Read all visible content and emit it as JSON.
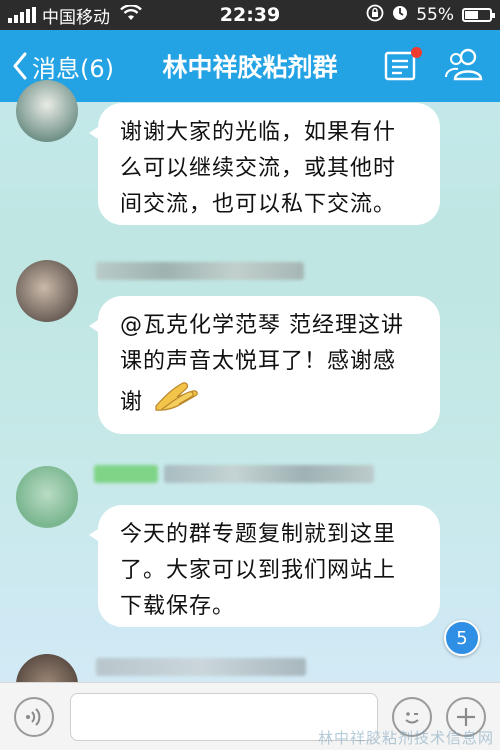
{
  "status_bar": {
    "carrier": "中国移动",
    "time": "22:39",
    "battery": "55%",
    "battery_level": 0.55
  },
  "nav": {
    "back_label": "消息(6)",
    "title": "林中祥胶粘剂群",
    "icons": [
      "back-chevron-icon",
      "group-notice-icon",
      "group-members-icon"
    ]
  },
  "messages": [
    {
      "text": "谢谢大家的光临，如果有什么可以继续交流，或其他时间交流，也可以私下交流。"
    },
    {
      "text": "@瓦克化学范琴 范经理这讲课的声音太悦耳了！感谢感谢",
      "emoji": "applause-icon"
    },
    {
      "text": "今天的群专题复制就到这里了。大家可以到我们网站上下载保存。"
    }
  ],
  "unread_badge": "5",
  "input_bar": {
    "placeholder": "",
    "icons": [
      "voice-icon",
      "emoji-icon",
      "plus-icon"
    ]
  },
  "watermark": "林中祥胶粘剂技术信息网",
  "colors": {
    "nav": "#23a2e4",
    "status_bar": "#2c2c2c",
    "badge": "#2f8fe4"
  }
}
